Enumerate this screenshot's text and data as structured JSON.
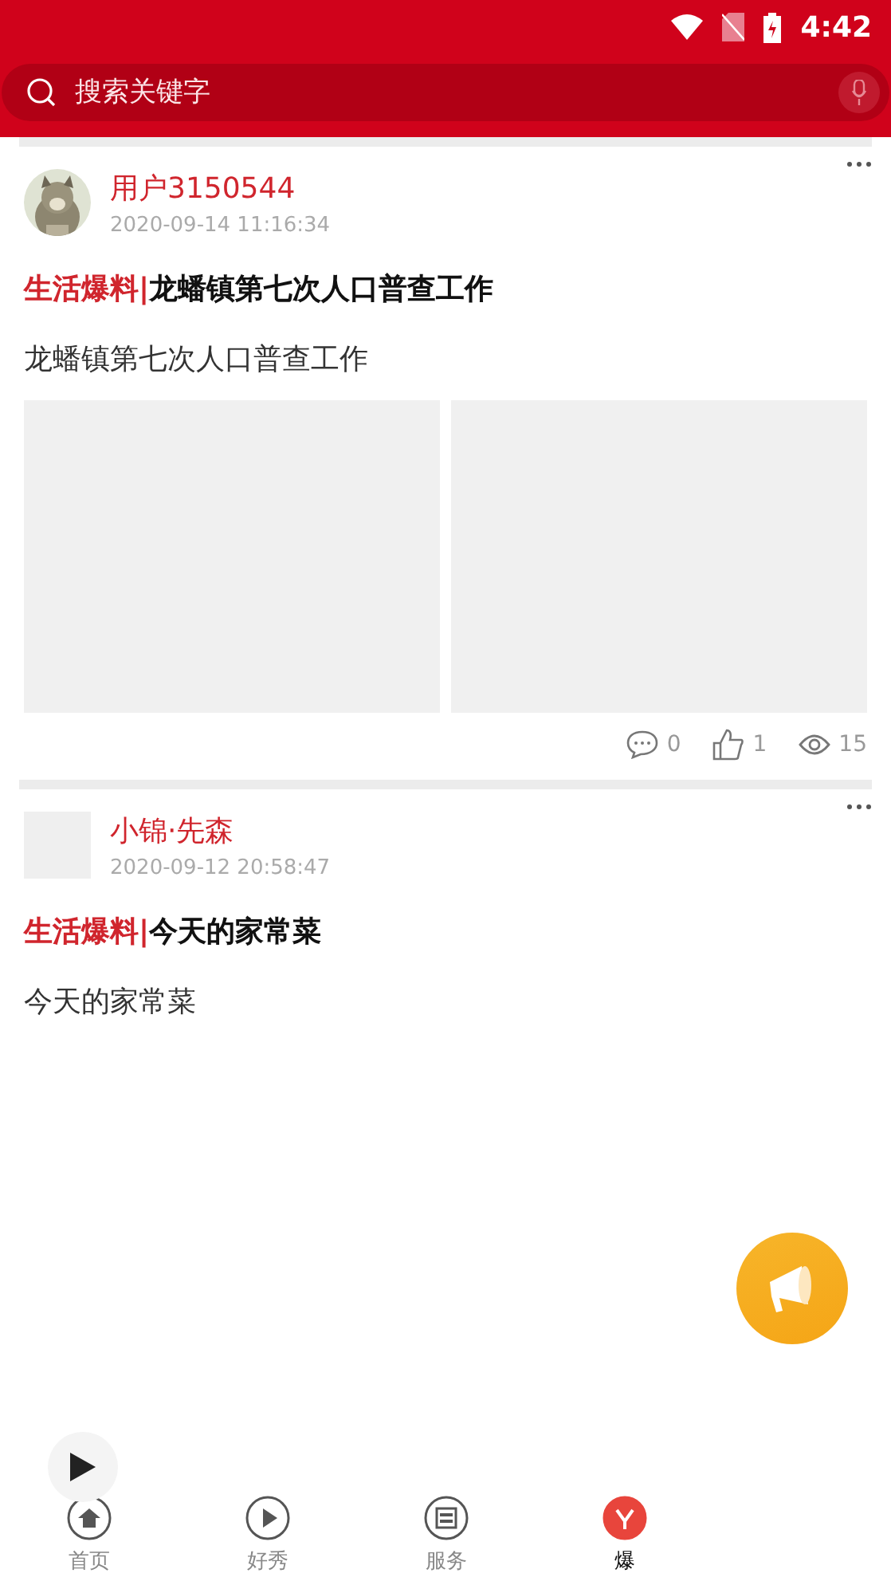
{
  "status_bar": {
    "time": "4:42"
  },
  "search": {
    "placeholder": "搜索关键字"
  },
  "posts": [
    {
      "author": "用户3150544",
      "time": "2020-09-14 11:16:34",
      "category": "生活爆料|",
      "title": "龙蟠镇第七次人口普查工作",
      "body": "龙蟠镇第七次人口普查工作",
      "images": [
        {
          "kind": "placeholder"
        },
        {
          "kind": "placeholder"
        }
      ],
      "stats": {
        "comments": "0",
        "likes": "1",
        "views": "15"
      }
    },
    {
      "avatar": {
        "kind": "placeholder"
      },
      "author": "小锦·先森",
      "time": "2020-09-12 20:58:47",
      "category": "生活爆料|",
      "title": "今天的家常菜",
      "body": "今天的家常菜"
    }
  ],
  "tabs": [
    {
      "label": "首页",
      "kind": "home",
      "selected": false
    },
    {
      "label": "好秀",
      "kind": "play",
      "selected": false
    },
    {
      "label": "服务",
      "kind": "news",
      "selected": false
    },
    {
      "label": "爆",
      "kind": "burst",
      "selected": true
    }
  ]
}
